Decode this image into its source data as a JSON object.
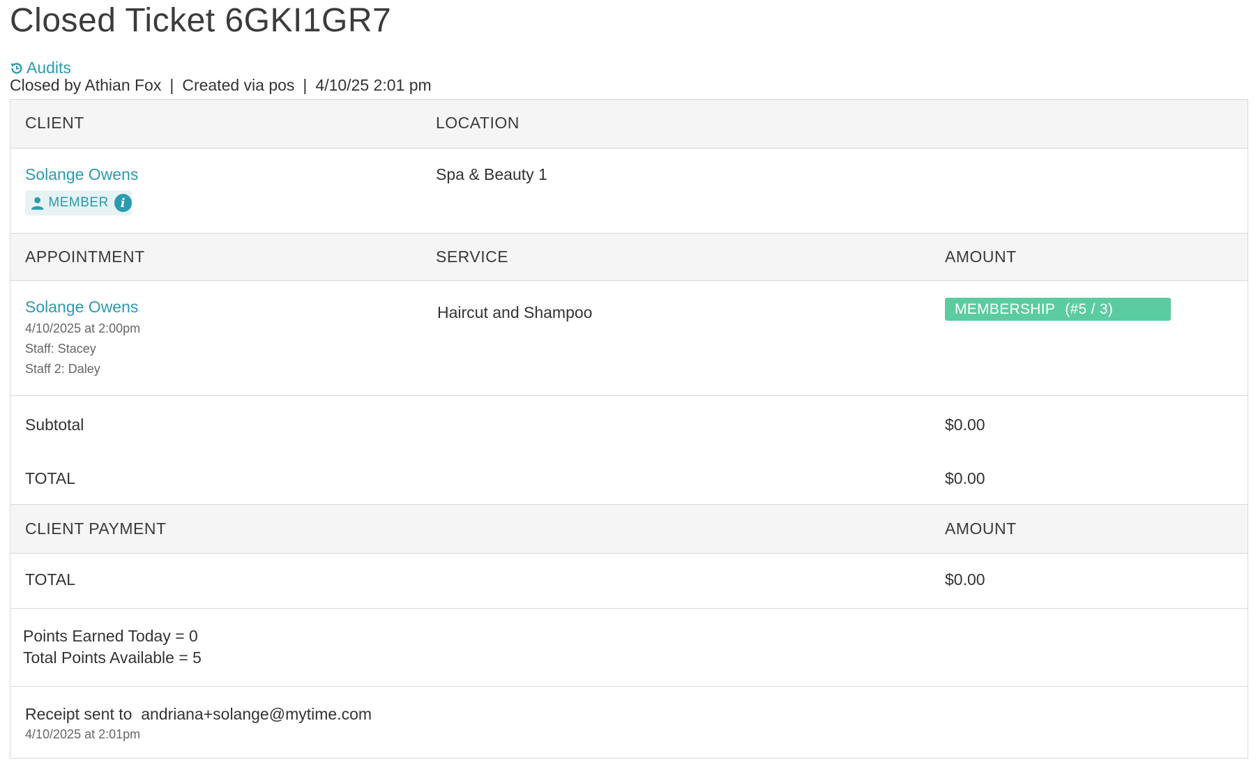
{
  "page": {
    "title": "Closed Ticket 6GKI1GR7",
    "audits_label": "Audits",
    "closed_by": "Closed by Athian Fox",
    "created_via": "Created via pos",
    "closed_at": "4/10/25 2:01 pm"
  },
  "client_section": {
    "client_header": "CLIENT",
    "location_header": "LOCATION",
    "client_name": "Solange Owens",
    "member_badge": "MEMBER",
    "location": "Spa & Beauty 1"
  },
  "appointment_section": {
    "appointment_header": "APPOINTMENT",
    "service_header": "SERVICE",
    "amount_header": "AMOUNT",
    "client_name": "Solange Owens",
    "datetime": "4/10/2025 at 2:00pm",
    "staff": "Staff: Stacey",
    "staff2": "Staff 2: Daley",
    "service": "Haircut and Shampoo",
    "membership_label": "MEMBERSHIP",
    "membership_count": "(#5 / 3)"
  },
  "totals": {
    "subtotal_label": "Subtotal",
    "subtotal_value": "$0.00",
    "total_label": "TOTAL",
    "total_value": "$0.00"
  },
  "payment_section": {
    "payment_header": "CLIENT PAYMENT",
    "amount_header": "AMOUNT",
    "total_label": "TOTAL",
    "total_value": "$0.00"
  },
  "points": {
    "earned_today": "Points Earned Today = 0",
    "total_available": "Total Points Available = 5"
  },
  "receipt": {
    "sent_to": "Receipt sent to  andriana+solange@mytime.com",
    "sent_at": "4/10/2025 at 2:01pm"
  },
  "colors": {
    "link": "#2a9bb0",
    "membership_tag": "#5bcc9f",
    "header_bg": "#f5f5f5"
  }
}
